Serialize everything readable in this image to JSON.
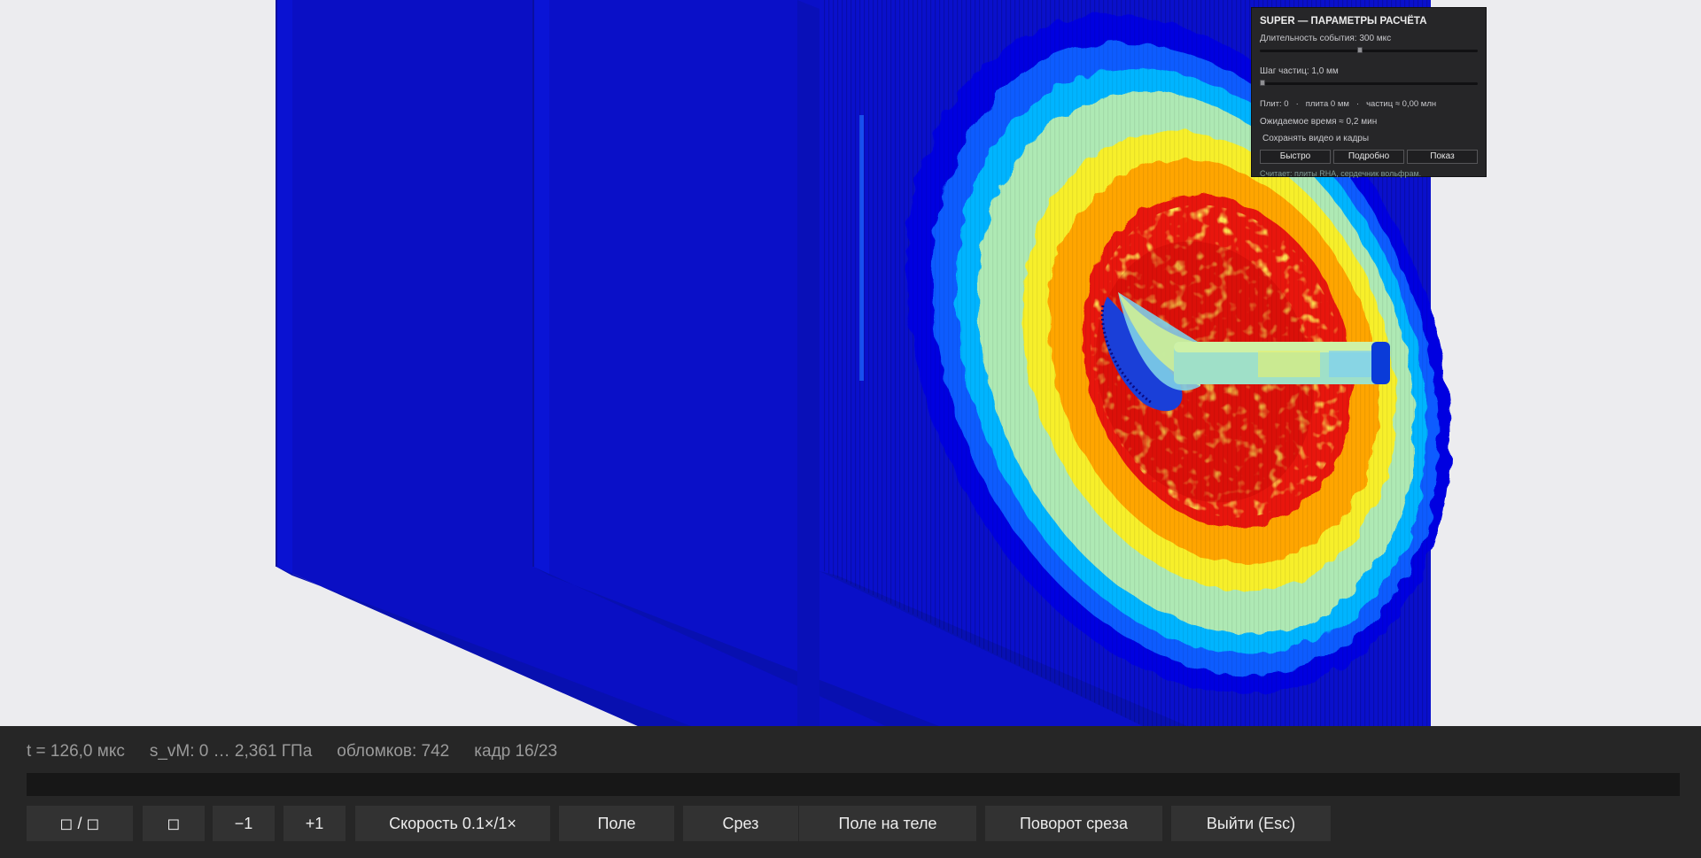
{
  "settings": {
    "title": "SUPER — ПАРАМЕТРЫ РАСЧЁТА",
    "duration": {
      "label": "Длительность события: 300 мкс",
      "fraction": 0.46
    },
    "step": {
      "label": "Шаг частиц: 1,0 мм",
      "fraction": 0.0
    },
    "info": [
      "Плит: 0",
      "·",
      "плита 0 мм",
      "·",
      "частиц ≈ 0,00 млн"
    ],
    "estimate": "Ожидаемое время ≈ 0,2 мин",
    "save_label": "Сохранять видео и кадры",
    "buttons": [
      "Быстро",
      "Подробно",
      "Показ"
    ],
    "note": "Считает: плиты RHA, сердечник вольфрам."
  },
  "status": {
    "time": "t = 126,0 мкс",
    "stress": "s_vM: 0 … 2,361 ГПа",
    "fragments": "обломков: 742",
    "frame": "кадр 16/23"
  },
  "progress_fraction": 0.0,
  "controls": [
    "◻ / ◻",
    "◻",
    "−1",
    "+1",
    "Скорость 0.1×/1×",
    "Поле",
    "Срез",
    "Поле на теле",
    "Поворот среза",
    "Выйти (Esc)"
  ],
  "colors": {
    "plate_blue": "#0a10c8",
    "scale": [
      "#0000c8",
      "#0a5cff",
      "#00b4ff",
      "#aee9b4",
      "#fff21e",
      "#ffa500",
      "#e8190f",
      "#b20000"
    ]
  }
}
